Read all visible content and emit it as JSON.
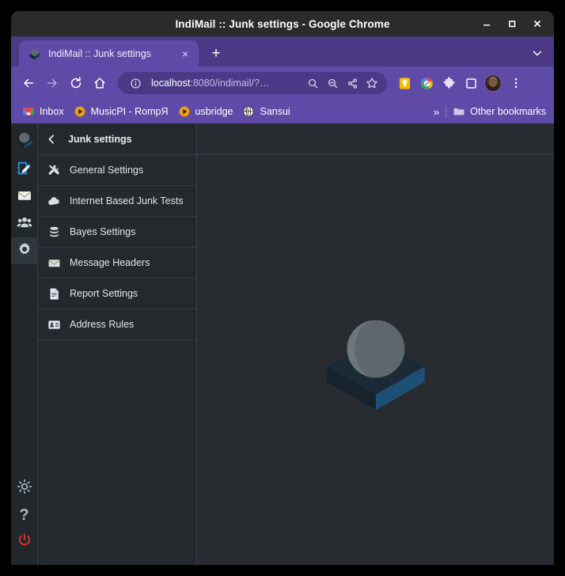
{
  "window": {
    "title": "IndiMail :: Junk settings - Google Chrome",
    "controls": {
      "minimize": "minimize-icon",
      "maximize": "maximize-icon",
      "close": "close-icon"
    }
  },
  "browser": {
    "tab": {
      "title": "IndiMail :: Junk settings",
      "favicon": "indimail-logo-icon",
      "close": "×"
    },
    "new_tab": "+",
    "tab_list_chevron": "chevron-down-icon",
    "nav": {
      "back": "back-arrow-icon",
      "forward": "forward-arrow-icon",
      "reload": "reload-icon",
      "home": "home-icon"
    },
    "omnibox": {
      "info_icon": "info-circle-icon",
      "url_scheme": "localhost",
      "url_rest": ":8080/indimail/?…",
      "url_full": "localhost:8080/indimail/?…",
      "icons": [
        "search-icon",
        "zoom-out-icon",
        "share-icon",
        "bookmark-star-icon"
      ]
    },
    "extensions": [
      "keep-bulb-icon",
      "google-circle-icon",
      "puzzle-piece-icon",
      "square-panel-icon"
    ],
    "profile": "avatar",
    "menu": "three-dot-menu-icon",
    "bookmarks": [
      {
        "label": "Inbox",
        "icon": "gmail-icon"
      },
      {
        "label": "MusicPI - RompЯ",
        "icon": "play-circle-icon"
      },
      {
        "label": "usbridge",
        "icon": "play-circle-icon"
      },
      {
        "label": "Sansui",
        "icon": "globe-icon"
      }
    ],
    "bookmarks_overflow": "»",
    "other_bookmarks": {
      "label": "Other bookmarks",
      "icon": "folder-icon"
    }
  },
  "app": {
    "rail": {
      "logo": "indimail-logo-icon",
      "items": [
        {
          "name": "compose",
          "icon": "compose-pencil-icon"
        },
        {
          "name": "mail",
          "icon": "envelope-icon"
        },
        {
          "name": "contacts",
          "icon": "people-icon"
        },
        {
          "name": "settings",
          "icon": "gear-icon",
          "active": true
        }
      ],
      "bottom": [
        {
          "name": "theme",
          "icon": "brightness-sun-icon"
        },
        {
          "name": "help",
          "icon": "question-mark-icon",
          "glyph": "?"
        },
        {
          "name": "logout",
          "icon": "power-icon"
        }
      ]
    },
    "settings_panel": {
      "back": "chevron-left-icon",
      "title": "Junk settings",
      "items": [
        {
          "label": "General Settings",
          "icon": "tools-icon"
        },
        {
          "label": "Internet Based Junk Tests",
          "icon": "cloud-icon"
        },
        {
          "label": "Bayes Settings",
          "icon": "database-icon"
        },
        {
          "label": "Message Headers",
          "icon": "envelope-icon"
        },
        {
          "label": "Report Settings",
          "icon": "document-icon"
        },
        {
          "label": "Address Rules",
          "icon": "contact-card-icon"
        }
      ]
    },
    "content": {
      "placeholder_logo": "indimail-logo-icon"
    }
  },
  "colors": {
    "chrome_purple": "#5f4aa8",
    "chrome_purple_dark": "#4a3a86",
    "titlebar": "#2b2b2b",
    "app_bg": "#282c31",
    "panel_bg": "#24292d",
    "rail_bg": "#22272b",
    "divider": "#39434a",
    "accent_blue": "#1e9bf0",
    "logo_blue": "#1d5076",
    "logo_dark": "#1b2a36",
    "logo_sphere": "#5e686c",
    "logout_red": "#e03131"
  }
}
